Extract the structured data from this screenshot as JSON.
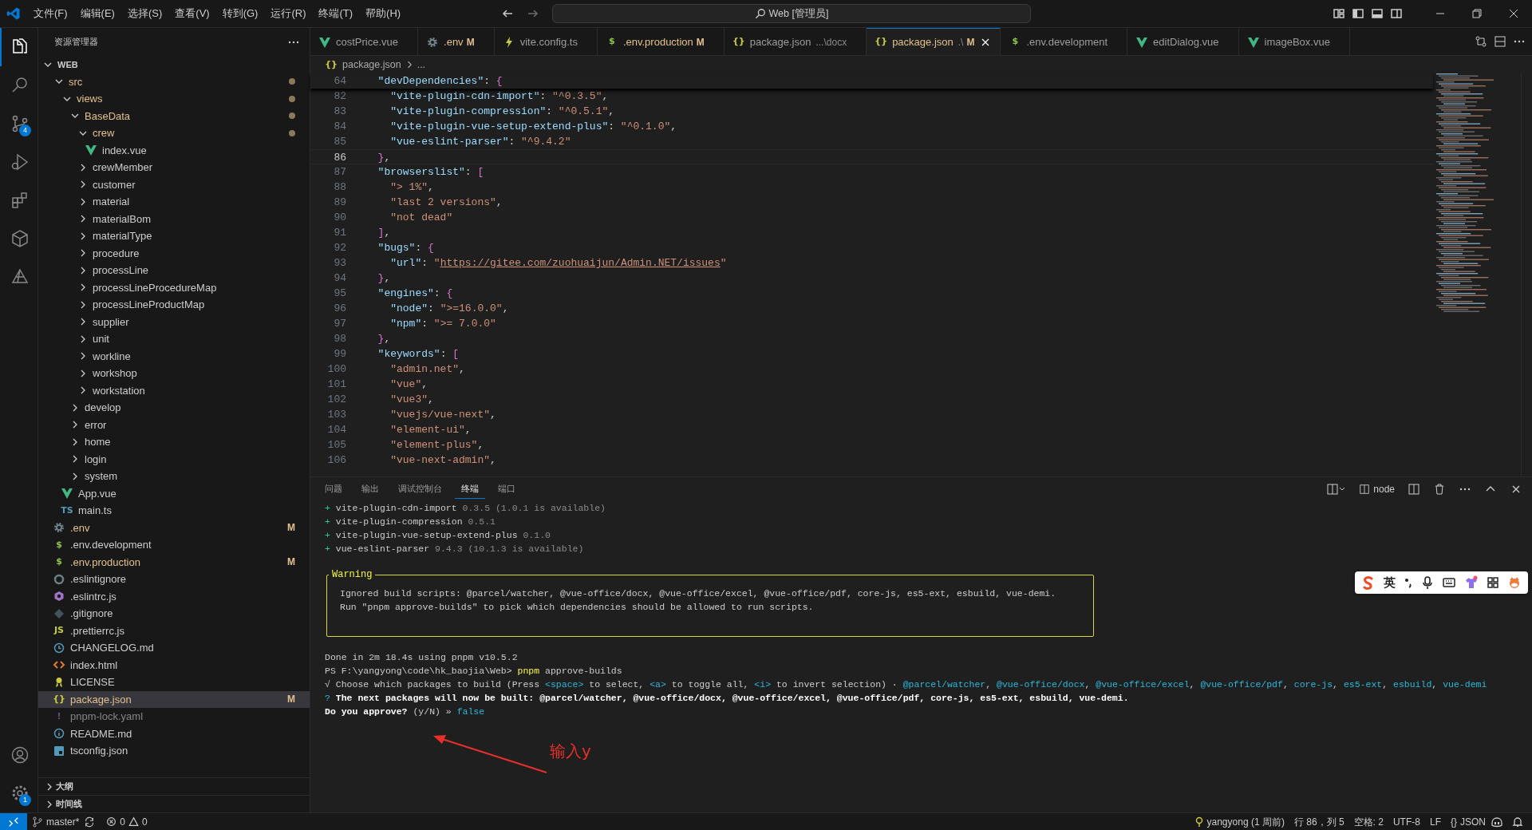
{
  "title_bar": {
    "menu": [
      "文件(F)",
      "编辑(E)",
      "选择(S)",
      "查看(V)",
      "转到(G)",
      "运行(R)",
      "终端(T)",
      "帮助(H)"
    ],
    "command_center": "Web [管理员]"
  },
  "activity_bar": {
    "items": [
      {
        "kind": "explorer",
        "selected": true
      },
      {
        "kind": "search",
        "selected": false
      },
      {
        "kind": "scm",
        "selected": false,
        "badge": "4"
      },
      {
        "kind": "run",
        "selected": false
      },
      {
        "kind": "extensions",
        "selected": false
      },
      {
        "kind": "cube",
        "selected": false
      },
      {
        "kind": "triangle",
        "selected": false
      }
    ],
    "bottom": [
      {
        "kind": "account",
        "selected": false
      },
      {
        "kind": "settings",
        "selected": false,
        "badge": "1"
      }
    ]
  },
  "sidebar": {
    "title": "资源管理器",
    "tree": [
      {
        "label": "WEB",
        "kind": "root",
        "expanded": true,
        "selected": false,
        "modified": false,
        "ignored": false,
        "children": [
          {
            "label": "src",
            "kind": "folder",
            "expanded": true,
            "selected": false,
            "modified": true,
            "ignored": false,
            "children": [
              {
                "label": "views",
                "kind": "folder",
                "expanded": true,
                "selected": false,
                "modified": true,
                "ignored": false,
                "children": [
                  {
                    "label": "BaseData",
                    "kind": "folder",
                    "expanded": true,
                    "selected": false,
                    "modified": true,
                    "ignored": false,
                    "children": [
                      {
                        "label": "crew",
                        "kind": "folder",
                        "expanded": true,
                        "selected": false,
                        "modified": true,
                        "ignored": false,
                        "children": [
                          {
                            "label": "index.vue",
                            "kind": "vue",
                            "selected": false,
                            "modified": false,
                            "ignored": false
                          }
                        ]
                      },
                      {
                        "label": "crewMember",
                        "kind": "folder",
                        "expanded": false,
                        "selected": false,
                        "modified": false,
                        "ignored": false
                      },
                      {
                        "label": "customer",
                        "kind": "folder",
                        "expanded": false,
                        "selected": false,
                        "modified": false,
                        "ignored": false
                      },
                      {
                        "label": "material",
                        "kind": "folder",
                        "expanded": false,
                        "selected": false,
                        "modified": false,
                        "ignored": false
                      },
                      {
                        "label": "materialBom",
                        "kind": "folder",
                        "expanded": false,
                        "selected": false,
                        "modified": false,
                        "ignored": false
                      },
                      {
                        "label": "materialType",
                        "kind": "folder",
                        "expanded": false,
                        "selected": false,
                        "modified": false,
                        "ignored": false
                      },
                      {
                        "label": "procedure",
                        "kind": "folder",
                        "expanded": false,
                        "selected": false,
                        "modified": false,
                        "ignored": false
                      },
                      {
                        "label": "processLine",
                        "kind": "folder",
                        "expanded": false,
                        "selected": false,
                        "modified": false,
                        "ignored": false
                      },
                      {
                        "label": "processLineProcedureMap",
                        "kind": "folder",
                        "expanded": false,
                        "selected": false,
                        "modified": false,
                        "ignored": false
                      },
                      {
                        "label": "processLineProductMap",
                        "kind": "folder",
                        "expanded": false,
                        "selected": false,
                        "modified": false,
                        "ignored": false
                      },
                      {
                        "label": "supplier",
                        "kind": "folder",
                        "expanded": false,
                        "selected": false,
                        "modified": false,
                        "ignored": false
                      },
                      {
                        "label": "unit",
                        "kind": "folder",
                        "expanded": false,
                        "selected": false,
                        "modified": false,
                        "ignored": false
                      },
                      {
                        "label": "workline",
                        "kind": "folder",
                        "expanded": false,
                        "selected": false,
                        "modified": false,
                        "ignored": false
                      },
                      {
                        "label": "workshop",
                        "kind": "folder",
                        "expanded": false,
                        "selected": false,
                        "modified": false,
                        "ignored": false
                      },
                      {
                        "label": "workstation",
                        "kind": "folder",
                        "expanded": false,
                        "selected": false,
                        "modified": false,
                        "ignored": false
                      }
                    ]
                  },
                  {
                    "label": "develop",
                    "kind": "folder",
                    "expanded": false,
                    "selected": false,
                    "modified": false,
                    "ignored": false
                  },
                  {
                    "label": "error",
                    "kind": "folder",
                    "expanded": false,
                    "selected": false,
                    "modified": false,
                    "ignored": false
                  },
                  {
                    "label": "home",
                    "kind": "folder",
                    "expanded": false,
                    "selected": false,
                    "modified": false,
                    "ignored": false
                  },
                  {
                    "label": "login",
                    "kind": "folder",
                    "expanded": false,
                    "selected": false,
                    "modified": false,
                    "ignored": false
                  },
                  {
                    "label": "system",
                    "kind": "folder",
                    "expanded": false,
                    "selected": false,
                    "modified": false,
                    "ignored": false
                  }
                ]
              },
              {
                "label": "App.vue",
                "kind": "vue",
                "selected": false,
                "modified": false,
                "ignored": false
              },
              {
                "label": "main.ts",
                "kind": "ts",
                "glyph": "TS",
                "selected": false,
                "modified": false,
                "ignored": false
              }
            ]
          },
          {
            "label": ".env",
            "kind": "gear",
            "selected": false,
            "modified": true,
            "ignored": false,
            "badge": "M"
          },
          {
            "label": ".env.development",
            "kind": "dollar",
            "glyph": "$",
            "selected": false,
            "modified": false,
            "ignored": false
          },
          {
            "label": ".env.production",
            "kind": "dollar",
            "glyph": "$",
            "selected": false,
            "modified": true,
            "ignored": false,
            "badge": "M"
          },
          {
            "label": ".eslintignore",
            "kind": "circle",
            "selected": false,
            "modified": false,
            "ignored": false
          },
          {
            "label": ".eslintrc.js",
            "kind": "hexagon",
            "selected": false,
            "modified": false,
            "ignored": false
          },
          {
            "label": ".gitignore",
            "kind": "diamond",
            "selected": false,
            "modified": false,
            "ignored": false
          },
          {
            "label": ".prettierrc.js",
            "kind": "js",
            "glyph": "JS",
            "selected": false,
            "modified": false,
            "ignored": false
          },
          {
            "label": "CHANGELOG.md",
            "kind": "clock",
            "selected": false,
            "modified": false,
            "ignored": false
          },
          {
            "label": "index.html",
            "kind": "html",
            "selected": false,
            "modified": false,
            "ignored": false
          },
          {
            "label": "LICENSE",
            "kind": "ribbon",
            "selected": false,
            "modified": false,
            "ignored": false
          },
          {
            "label": "package.json",
            "kind": "json",
            "glyph": "{}",
            "selected": true,
            "modified": true,
            "ignored": false,
            "badge": "M"
          },
          {
            "label": "pnpm-lock.yaml",
            "kind": "yaml",
            "glyph": "!",
            "selected": false,
            "modified": false,
            "ignored": true
          },
          {
            "label": "README.md",
            "kind": "info",
            "selected": false,
            "modified": false,
            "ignored": false
          },
          {
            "label": "tsconfig.json",
            "kind": "square",
            "selected": false,
            "modified": false,
            "ignored": false
          }
        ]
      }
    ],
    "sections": [
      {
        "label": "大纲",
        "expanded": false
      },
      {
        "label": "时间线",
        "expanded": false
      }
    ]
  },
  "tabs": [
    {
      "label": "costPrice.vue",
      "kind": "vue",
      "selected": false,
      "modified": false
    },
    {
      "label": ".env",
      "kind": "gear",
      "selected": false,
      "modified": true,
      "badge": "M"
    },
    {
      "label": "vite.config.ts",
      "kind": "bolt",
      "selected": false,
      "modified": false
    },
    {
      "label": ".env.production",
      "kind": "dollar",
      "glyph": "$",
      "selected": false,
      "modified": true,
      "badge": "M"
    },
    {
      "label": "package.json",
      "kind": "json",
      "glyph": "{}",
      "selected": false,
      "modified": false,
      "description": "...\\docx"
    },
    {
      "label": "package.json",
      "kind": "json",
      "glyph": "{}",
      "selected": true,
      "modified": true,
      "description": ".\\",
      "badge": "M"
    },
    {
      "label": ".env.development",
      "kind": "dollar",
      "glyph": "$",
      "selected": false,
      "modified": false
    },
    {
      "label": "editDialog.vue",
      "kind": "vue",
      "selected": false,
      "modified": false
    },
    {
      "label": "imageBox.vue",
      "kind": "vue",
      "selected": false,
      "modified": false
    }
  ],
  "breadcrumb": {
    "glyph": "{}",
    "file": "package.json",
    "rest": "..."
  },
  "editor": {
    "sticky_lines": [
      {
        "number": "64",
        "current": false,
        "tokens": [
          {
            "text": "  \"devDependencies\"",
            "kind": "key"
          },
          {
            "text": ": ",
            "kind": "punct"
          },
          {
            "text": "{",
            "kind": "bracket"
          }
        ]
      }
    ],
    "lines": [
      {
        "number": "82",
        "current": false,
        "tokens": [
          {
            "text": "    \"vite-plugin-cdn-import\"",
            "kind": "key"
          },
          {
            "text": ": ",
            "kind": "punct"
          },
          {
            "text": "\"^0.3.5\"",
            "kind": "string"
          },
          {
            "text": ",",
            "kind": "punct"
          }
        ]
      },
      {
        "number": "83",
        "current": false,
        "tokens": [
          {
            "text": "    \"vite-plugin-compression\"",
            "kind": "key"
          },
          {
            "text": ": ",
            "kind": "punct"
          },
          {
            "text": "\"^0.5.1\"",
            "kind": "string"
          },
          {
            "text": ",",
            "kind": "punct"
          }
        ]
      },
      {
        "number": "84",
        "current": false,
        "tokens": [
          {
            "text": "    \"vite-plugin-vue-setup-extend-plus\"",
            "kind": "key"
          },
          {
            "text": ": ",
            "kind": "punct"
          },
          {
            "text": "\"^0.1.0\"",
            "kind": "string"
          },
          {
            "text": ",",
            "kind": "punct"
          }
        ]
      },
      {
        "number": "85",
        "current": false,
        "tokens": [
          {
            "text": "    \"vue-eslint-parser\"",
            "kind": "key"
          },
          {
            "text": ": ",
            "kind": "punct"
          },
          {
            "text": "\"^9.4.2\"",
            "kind": "string"
          }
        ]
      },
      {
        "number": "86",
        "current": true,
        "tokens": [
          {
            "text": "  }",
            "kind": "bracket"
          },
          {
            "text": ",",
            "kind": "punct"
          }
        ]
      },
      {
        "number": "87",
        "current": false,
        "tokens": [
          {
            "text": "  \"browserslist\"",
            "kind": "key"
          },
          {
            "text": ": ",
            "kind": "punct"
          },
          {
            "text": "[",
            "kind": "bracket"
          }
        ]
      },
      {
        "number": "88",
        "current": false,
        "tokens": [
          {
            "text": "    \"> 1%\"",
            "kind": "string"
          },
          {
            "text": ",",
            "kind": "punct"
          }
        ]
      },
      {
        "number": "89",
        "current": false,
        "tokens": [
          {
            "text": "    \"last 2 versions\"",
            "kind": "string"
          },
          {
            "text": ",",
            "kind": "punct"
          }
        ]
      },
      {
        "number": "90",
        "current": false,
        "tokens": [
          {
            "text": "    \"not dead\"",
            "kind": "string"
          }
        ]
      },
      {
        "number": "91",
        "current": false,
        "tokens": [
          {
            "text": "  ]",
            "kind": "bracket"
          },
          {
            "text": ",",
            "kind": "punct"
          }
        ]
      },
      {
        "number": "92",
        "current": false,
        "tokens": [
          {
            "text": "  \"bugs\"",
            "kind": "key"
          },
          {
            "text": ": ",
            "kind": "punct"
          },
          {
            "text": "{",
            "kind": "bracket"
          }
        ]
      },
      {
        "number": "93",
        "current": false,
        "tokens": [
          {
            "text": "    \"url\"",
            "kind": "key"
          },
          {
            "text": ": ",
            "kind": "punct"
          },
          {
            "text": "\"",
            "kind": "string"
          },
          {
            "text": "https://gitee.com/zuohuaijun/Admin.NET/issues",
            "kind": "link"
          },
          {
            "text": "\"",
            "kind": "string"
          }
        ]
      },
      {
        "number": "94",
        "current": false,
        "tokens": [
          {
            "text": "  }",
            "kind": "bracket"
          },
          {
            "text": ",",
            "kind": "punct"
          }
        ]
      },
      {
        "number": "95",
        "current": false,
        "tokens": [
          {
            "text": "  \"engines\"",
            "kind": "key"
          },
          {
            "text": ": ",
            "kind": "punct"
          },
          {
            "text": "{",
            "kind": "bracket"
          }
        ]
      },
      {
        "number": "96",
        "current": false,
        "tokens": [
          {
            "text": "    \"node\"",
            "kind": "key"
          },
          {
            "text": ": ",
            "kind": "punct"
          },
          {
            "text": "\">=16.0.0\"",
            "kind": "string"
          },
          {
            "text": ",",
            "kind": "punct"
          }
        ]
      },
      {
        "number": "97",
        "current": false,
        "tokens": [
          {
            "text": "    \"npm\"",
            "kind": "key"
          },
          {
            "text": ": ",
            "kind": "punct"
          },
          {
            "text": "\">= 7.0.0\"",
            "kind": "string"
          }
        ]
      },
      {
        "number": "98",
        "current": false,
        "tokens": [
          {
            "text": "  }",
            "kind": "bracket"
          },
          {
            "text": ",",
            "kind": "punct"
          }
        ]
      },
      {
        "number": "99",
        "current": false,
        "tokens": [
          {
            "text": "  \"keywords\"",
            "kind": "key"
          },
          {
            "text": ": ",
            "kind": "punct"
          },
          {
            "text": "[",
            "kind": "bracket"
          }
        ]
      },
      {
        "number": "100",
        "current": false,
        "tokens": [
          {
            "text": "    \"admin.net\"",
            "kind": "string"
          },
          {
            "text": ",",
            "kind": "punct"
          }
        ]
      },
      {
        "number": "101",
        "current": false,
        "tokens": [
          {
            "text": "    \"vue\"",
            "kind": "string"
          },
          {
            "text": ",",
            "kind": "punct"
          }
        ]
      },
      {
        "number": "102",
        "current": false,
        "tokens": [
          {
            "text": "    \"vue3\"",
            "kind": "string"
          },
          {
            "text": ",",
            "kind": "punct"
          }
        ]
      },
      {
        "number": "103",
        "current": false,
        "tokens": [
          {
            "text": "    \"vuejs/vue-next\"",
            "kind": "string"
          },
          {
            "text": ",",
            "kind": "punct"
          }
        ]
      },
      {
        "number": "104",
        "current": false,
        "tokens": [
          {
            "text": "    \"element-ui\"",
            "kind": "string"
          },
          {
            "text": ",",
            "kind": "punct"
          }
        ]
      },
      {
        "number": "105",
        "current": false,
        "tokens": [
          {
            "text": "    \"element-plus\"",
            "kind": "string"
          },
          {
            "text": ",",
            "kind": "punct"
          }
        ]
      },
      {
        "number": "106",
        "current": false,
        "tokens": [
          {
            "text": "    \"vue-next-admin\"",
            "kind": "string"
          },
          {
            "text": ",",
            "kind": "punct"
          }
        ]
      }
    ]
  },
  "panel": {
    "tabs": [
      {
        "label": "问题",
        "selected": false
      },
      {
        "label": "输出",
        "selected": false
      },
      {
        "label": "调试控制台",
        "selected": false
      },
      {
        "label": "终端",
        "selected": true
      },
      {
        "label": "端口",
        "selected": false
      }
    ],
    "terminal_name": "node",
    "terminal": [
      {
        "kind": "line",
        "tokens": [
          {
            "text": "+ ",
            "kind": "green"
          },
          {
            "text": "vite-plugin-cdn-import",
            "kind": "plain"
          },
          {
            "text": " 0.3.5 (1.0.1 is available)",
            "kind": "dim"
          }
        ]
      },
      {
        "kind": "line",
        "tokens": [
          {
            "text": "+ ",
            "kind": "green"
          },
          {
            "text": "vite-plugin-compression",
            "kind": "plain"
          },
          {
            "text": " 0.5.1",
            "kind": "dim"
          }
        ]
      },
      {
        "kind": "line",
        "tokens": [
          {
            "text": "+ ",
            "kind": "green"
          },
          {
            "text": "vite-plugin-vue-setup-extend-plus",
            "kind": "plain"
          },
          {
            "text": " 0.1.0",
            "kind": "dim"
          }
        ]
      },
      {
        "kind": "line",
        "tokens": [
          {
            "text": "+ ",
            "kind": "green"
          },
          {
            "text": "vue-eslint-parser",
            "kind": "plain"
          },
          {
            "text": " 9.4.3 (10.1.3 is available)",
            "kind": "dim"
          }
        ]
      },
      {
        "kind": "blank"
      },
      {
        "kind": "box",
        "title": "Warning",
        "lines": [
          "Ignored build scripts: @parcel/watcher, @vue-office/docx, @vue-office/excel, @vue-office/pdf, core-js, es5-ext, esbuild, vue-demi.",
          "Run \"pnpm approve-builds\" to pick which dependencies should be allowed to run scripts."
        ]
      },
      {
        "kind": "blank"
      },
      {
        "kind": "line",
        "tokens": [
          {
            "text": "Done in 2m 18.4s using pnpm v10.5.2",
            "kind": "plain"
          }
        ]
      },
      {
        "kind": "line",
        "tokens": [
          {
            "text": "PS F:\\yangyong\\code\\hk_baojia\\Web> ",
            "kind": "plain"
          },
          {
            "text": "pnpm",
            "kind": "yellow"
          },
          {
            "text": " approve-builds",
            "kind": "plain"
          }
        ]
      },
      {
        "kind": "line",
        "tokens": [
          {
            "text": "√ Choose which packages to build (Press ",
            "kind": "plain"
          },
          {
            "text": "<space>",
            "kind": "cyan"
          },
          {
            "text": " to select, ",
            "kind": "plain"
          },
          {
            "text": "<a>",
            "kind": "cyan"
          },
          {
            "text": " to toggle all, ",
            "kind": "plain"
          },
          {
            "text": "<i>",
            "kind": "cyan"
          },
          {
            "text": " to invert selection) · ",
            "kind": "plain"
          },
          {
            "text": "@parcel/watcher",
            "kind": "cyan"
          },
          {
            "text": ", ",
            "kind": "plain"
          },
          {
            "text": "@vue-office/docx",
            "kind": "cyan"
          },
          {
            "text": ", ",
            "kind": "plain"
          },
          {
            "text": "@vue-office/excel",
            "kind": "cyan"
          },
          {
            "text": ", ",
            "kind": "plain"
          },
          {
            "text": "@vue-office/pdf",
            "kind": "cyan"
          },
          {
            "text": ", ",
            "kind": "plain"
          },
          {
            "text": "core-js",
            "kind": "cyan"
          },
          {
            "text": ", ",
            "kind": "plain"
          },
          {
            "text": "es5-ext",
            "kind": "cyan"
          },
          {
            "text": ", ",
            "kind": "plain"
          },
          {
            "text": "esbuild",
            "kind": "cyan"
          },
          {
            "text": ", ",
            "kind": "plain"
          },
          {
            "text": "vue-demi",
            "kind": "cyan"
          }
        ]
      },
      {
        "kind": "line",
        "tokens": [
          {
            "text": "? ",
            "kind": "cyan"
          },
          {
            "text": "The next packages will now be built: @parcel/watcher, @vue-office/docx, @vue-office/excel, @vue-office/pdf, core-js, es5-ext, esbuild, vue-demi.",
            "kind": "bold"
          }
        ]
      },
      {
        "kind": "line",
        "tokens": [
          {
            "text": "Do you approve? ",
            "kind": "bold"
          },
          {
            "text": "(y/N)",
            "kind": "plain"
          },
          {
            "text": " » ",
            "kind": "plain"
          },
          {
            "text": "false",
            "kind": "cyan"
          }
        ]
      }
    ]
  },
  "annotation": {
    "text": "输入y"
  },
  "ime_toolbar": {
    "language": "英"
  },
  "status_bar": {
    "branch": "master*",
    "errors": "0",
    "warnings": "0",
    "blame": "yangyong (1 周前)",
    "position": "行 86，列 5",
    "indent": "空格: 2",
    "encoding": "UTF-8",
    "eol": "LF",
    "language_glyph": "{}",
    "language": "JSON"
  }
}
